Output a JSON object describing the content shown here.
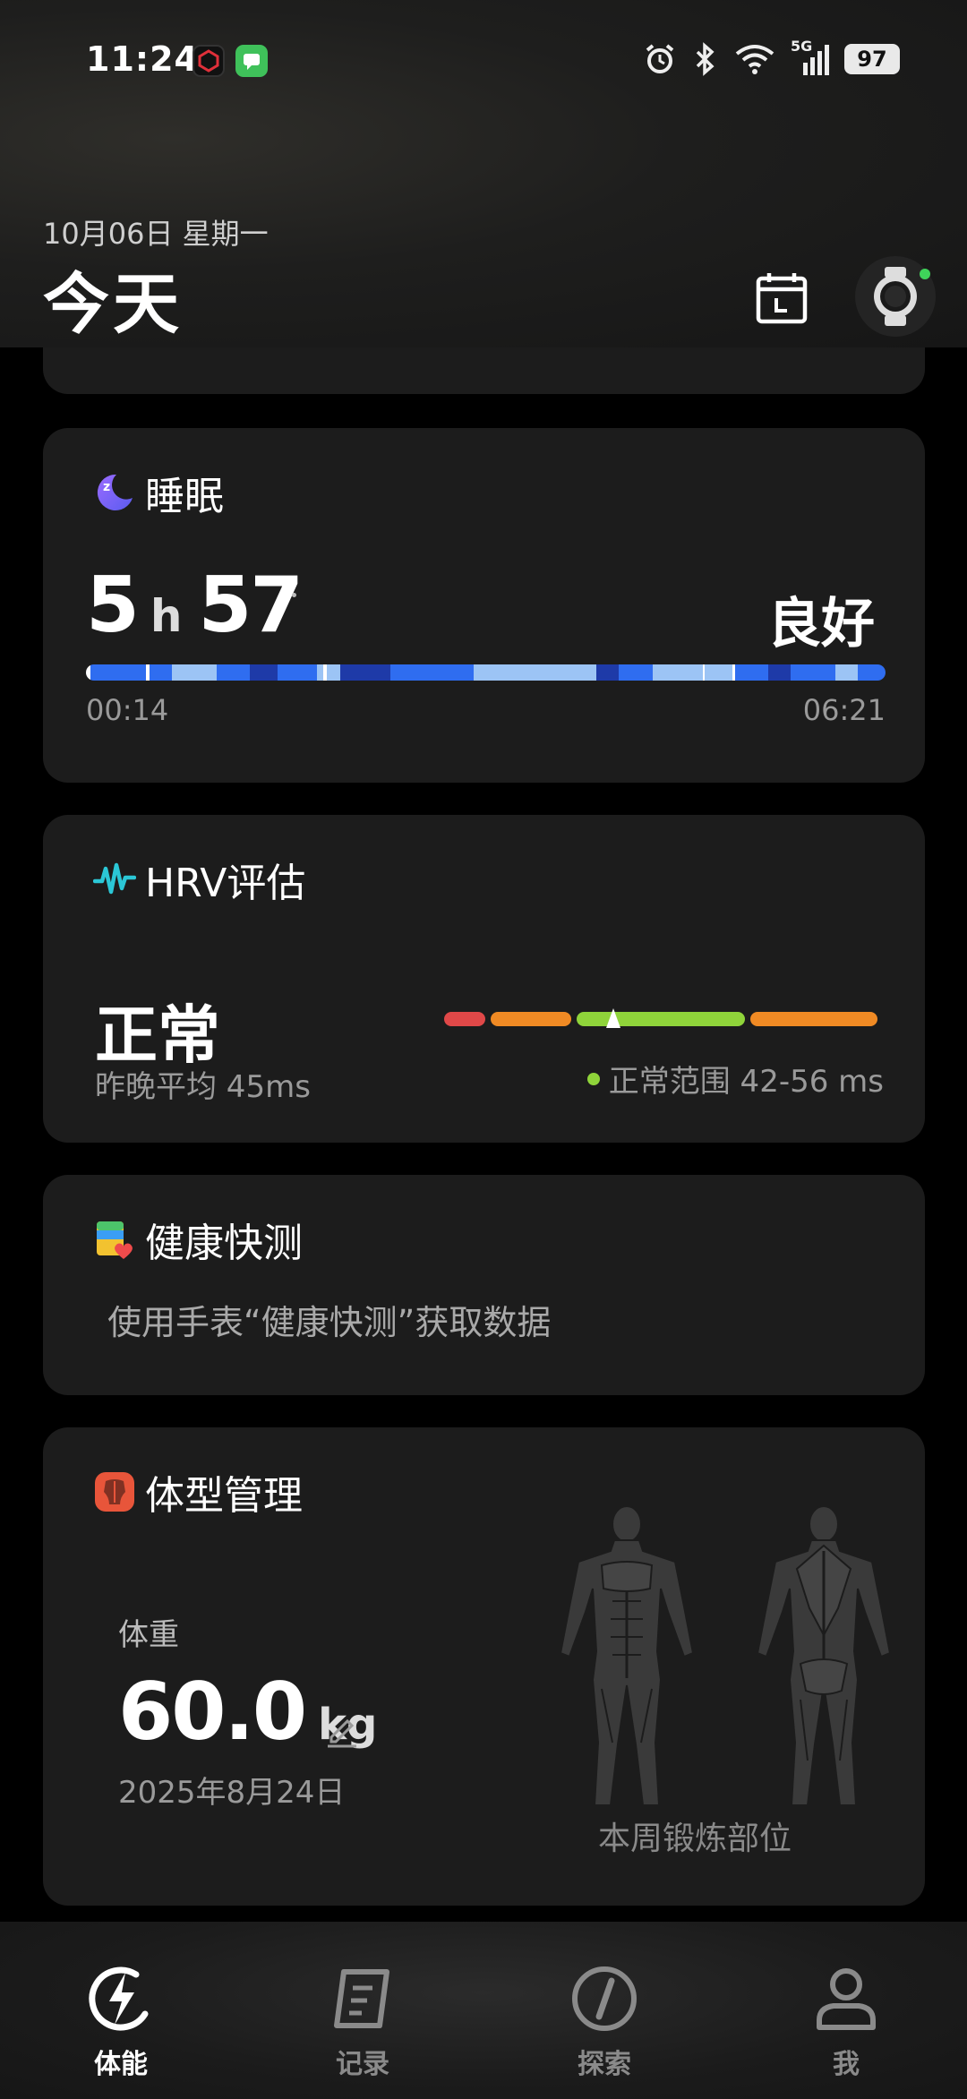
{
  "status_bar": {
    "time": "11:24",
    "network": "5G",
    "battery": "97"
  },
  "header": {
    "date": "10月06日 星期一",
    "title": "今天"
  },
  "sleep": {
    "title": "睡眠",
    "hours": "5",
    "hours_unit": "h",
    "minutes": "57",
    "quality": "良好",
    "start_time": "00:14",
    "end_time": "06:21",
    "stage_colors": {
      "deep": "#1e3aa8",
      "light": "#2f6df0",
      "rem": "#9cc4f5",
      "awake": "#ffffff"
    }
  },
  "hrv": {
    "title": "HRV评估",
    "status": "正常",
    "average": "昨晚平均 45ms",
    "range": "正常范围 42-56 ms",
    "colors": {
      "low": "#e04848",
      "mid": "#f08a24",
      "normal": "#8fd43a"
    }
  },
  "quick_check": {
    "title": "健康快测",
    "hint": "使用手表“健康快测”获取数据"
  },
  "body": {
    "title": "体型管理",
    "weight_label": "体重",
    "weight": "60.0",
    "weight_unit": "kg",
    "date": "2025年8月24日",
    "caption": "本周锻炼部位"
  },
  "nav": {
    "items": [
      {
        "label": "体能",
        "icon": "lightning-icon",
        "active": true
      },
      {
        "label": "记录",
        "icon": "note-icon",
        "active": false
      },
      {
        "label": "探索",
        "icon": "compass-icon",
        "active": false
      },
      {
        "label": "我",
        "icon": "person-icon",
        "active": false
      }
    ]
  }
}
